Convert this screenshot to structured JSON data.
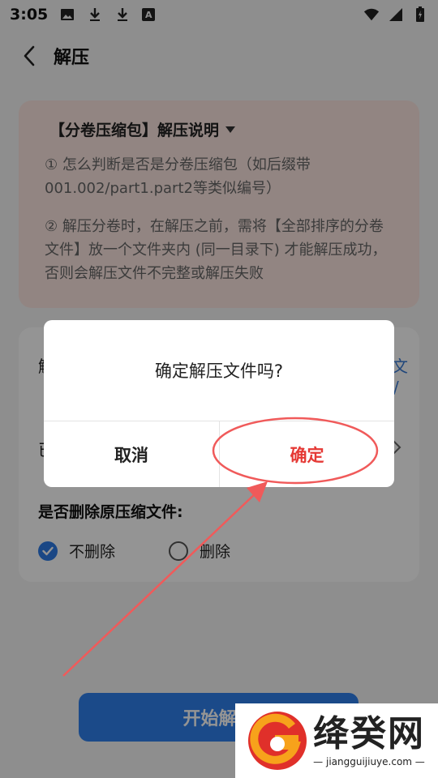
{
  "status_bar": {
    "time": "3:05",
    "left_icons": [
      "image-icon",
      "download-icon",
      "download-icon",
      "font-a-icon"
    ],
    "right_icons": [
      "wifi-icon",
      "signal-icon",
      "battery-icon"
    ],
    "font_icon_letter": "A"
  },
  "header": {
    "title": "解压"
  },
  "info_card": {
    "title": "【分卷压缩包】解压说明",
    "point1": "① 怎么判断是否是分卷压缩包（如后缀带001.002/part1.part2等类似编号）",
    "point2": "② 解压分卷时，在解压之前，需将【全部排序的分卷文件】放一个文件夹内 (同一目录下) 才能解压成功，否则会解压文件不完整或解压失败",
    "background": "#fbe6e1"
  },
  "settings_card": {
    "row1_peek": "解",
    "row1_right_peek_1": "文",
    "row1_right_peek_2": "/",
    "row2_peek": "已",
    "delete_label": "是否删除原压缩文件:",
    "option_keep": "不删除",
    "option_delete": "删除",
    "selected_option": "不删除"
  },
  "start_button": {
    "label": "开始解压"
  },
  "dialog": {
    "message": "确定解压文件吗?",
    "cancel_label": "取消",
    "confirm_label": "确定",
    "confirm_color": "#e53935"
  },
  "annotation": {
    "color": "#f05a5a"
  },
  "watermark": {
    "title": "绛癸网",
    "url": "— jiangguijiuye.com —"
  },
  "colors": {
    "accent": "#2f80ed",
    "radio_checked": "#2d7be5"
  }
}
